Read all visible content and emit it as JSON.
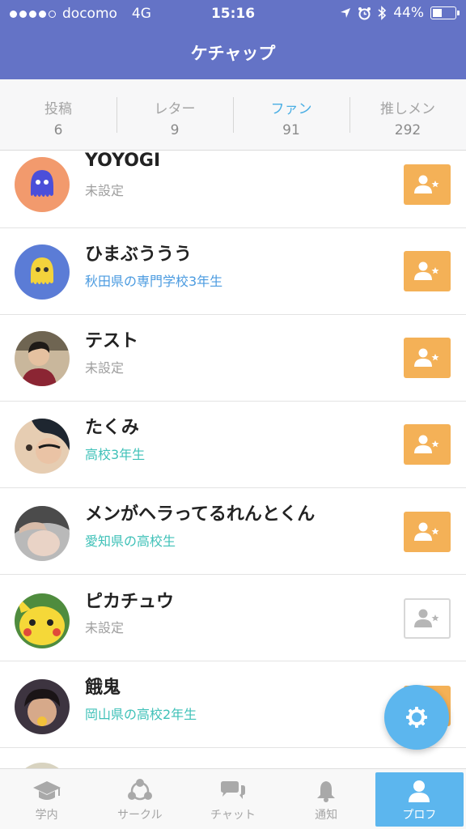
{
  "status_bar": {
    "carrier": "docomo",
    "network": "4G",
    "time": "15:16",
    "battery": "44%",
    "battery_level": 0.44,
    "signal_bars": 4
  },
  "header": {
    "title": "ケチャップ"
  },
  "stats": [
    {
      "label": "投稿",
      "count": "6",
      "active": false
    },
    {
      "label": "レター",
      "count": "9",
      "active": false
    },
    {
      "label": "ファン",
      "count": "91",
      "active": true
    },
    {
      "label": "推しメン",
      "count": "292",
      "active": false
    }
  ],
  "fans": [
    {
      "name": "YOYOGI",
      "subtitle": "未設定",
      "subtitle_color": "gray",
      "avatar_icon": "octopus-blue-avatar",
      "button_state": "filled"
    },
    {
      "name": "ひまぶううう",
      "subtitle": "秋田県の専門学校3年生",
      "subtitle_color": "blue",
      "avatar_icon": "octopus-yellow-avatar",
      "button_state": "filled"
    },
    {
      "name": "テスト",
      "subtitle": "未設定",
      "subtitle_color": "gray",
      "avatar_icon": "photo-avatar",
      "button_state": "filled"
    },
    {
      "name": "たくみ",
      "subtitle": "高校3年生",
      "subtitle_color": "teal",
      "avatar_icon": "photo-avatar",
      "button_state": "filled"
    },
    {
      "name": "メンがヘラってるれんとくん",
      "subtitle": "愛知県の高校生",
      "subtitle_color": "teal",
      "avatar_icon": "photo-avatar",
      "button_state": "filled"
    },
    {
      "name": "ピカチュウ",
      "subtitle": "未設定",
      "subtitle_color": "gray",
      "avatar_icon": "pikachu-avatar",
      "button_state": "outline"
    },
    {
      "name": "餓鬼",
      "subtitle": "岡山県の高校2年生",
      "subtitle_color": "teal",
      "avatar_icon": "photo-avatar",
      "button_state": "filled"
    }
  ],
  "fab": {
    "icon": "gear-icon"
  },
  "bottom_nav": [
    {
      "label": "学内",
      "icon": "graduation-cap-icon",
      "active": false
    },
    {
      "label": "サークル",
      "icon": "circle-network-icon",
      "active": false
    },
    {
      "label": "チャット",
      "icon": "chat-bubbles-icon",
      "active": false
    },
    {
      "label": "通知",
      "icon": "bell-icon",
      "active": false
    },
    {
      "label": "プロフ",
      "icon": "user-icon",
      "active": true
    }
  ],
  "colors": {
    "header": "#6473c6",
    "accent": "#5cb6ee",
    "fan_button": "#f4b157",
    "active_stat": "#4aaee4",
    "subtitle_blue": "#4b9be0",
    "subtitle_teal": "#3fc1b8"
  }
}
